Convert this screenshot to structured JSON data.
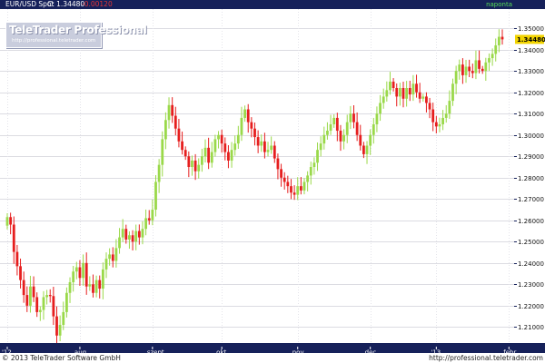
{
  "header": {
    "symbol": "EUR/USD Spot",
    "close": "C: 1.34480",
    "change": "-0.00120",
    "period": "naponta"
  },
  "logo": {
    "title": "TeleTrader Professional",
    "url": "http://professional.teletrader.com"
  },
  "footer": {
    "copyright": "© 2013 TeleTrader Software GmbH",
    "url": "http://professional.teletrader.com"
  },
  "colors": {
    "up": "#9ad94a",
    "down": "#e61e1e",
    "axis_bar": "#16215a",
    "last_price_box": "#f2d400"
  },
  "chart_data": {
    "type": "candlestick",
    "title": "",
    "xlabel": "",
    "ylabel": "",
    "ylim": [
      1.2025,
      1.359
    ],
    "grid": true,
    "y_axis_position": "right",
    "last_price": "1.34480",
    "y_ticks": [
      "1.21000",
      "1.22000",
      "1.23000",
      "1.24000",
      "1.25000",
      "1.26000",
      "1.27000",
      "1.28000",
      "1.29000",
      "1.30000",
      "1.31000",
      "1.32000",
      "1.33000",
      "1.34000",
      "1.35000"
    ],
    "x_tick_labels": [
      {
        "label": "'12",
        "index": 0
      },
      {
        "label": "aug.",
        "index": 22
      },
      {
        "label": "szept.",
        "index": 44
      },
      {
        "label": "okt.",
        "index": 65
      },
      {
        "label": "nov.",
        "index": 88
      },
      {
        "label": "dec.",
        "index": 110
      },
      {
        "label": "'13",
        "index": 130
      },
      {
        "label": "febr.",
        "index": 152
      }
    ],
    "closes": [
      1.2615,
      1.258,
      1.2452,
      1.2385,
      1.232,
      1.225,
      1.22,
      1.229,
      1.224,
      1.217,
      1.218,
      1.224,
      1.225,
      1.2245,
      1.215,
      1.206,
      1.211,
      1.217,
      1.226,
      1.231,
      1.236,
      1.238,
      1.233,
      1.24,
      1.229,
      1.23,
      1.226,
      1.232,
      1.228,
      1.237,
      1.242,
      1.244,
      1.241,
      1.247,
      1.252,
      1.256,
      1.251,
      1.253,
      1.25,
      1.255,
      1.252,
      1.256,
      1.261,
      1.26,
      1.265,
      1.278,
      1.286,
      1.298,
      1.307,
      1.314,
      1.309,
      1.303,
      1.297,
      1.293,
      1.29,
      1.285,
      1.288,
      1.283,
      1.286,
      1.29,
      1.294,
      1.287,
      1.292,
      1.298,
      1.3,
      1.296,
      1.292,
      1.288,
      1.293,
      1.296,
      1.3,
      1.308,
      1.312,
      1.306,
      1.303,
      1.299,
      1.295,
      1.297,
      1.292,
      1.293,
      1.295,
      1.289,
      1.284,
      1.28,
      1.278,
      1.276,
      1.273,
      1.272,
      1.276,
      1.274,
      1.278,
      1.281,
      1.285,
      1.287,
      1.293,
      1.296,
      1.3,
      1.302,
      1.305,
      1.308,
      1.302,
      1.297,
      1.3,
      1.306,
      1.31,
      1.306,
      1.3,
      1.295,
      1.291,
      1.295,
      1.3,
      1.305,
      1.31,
      1.315,
      1.318,
      1.321,
      1.325,
      1.322,
      1.318,
      1.322,
      1.317,
      1.322,
      1.319,
      1.324,
      1.32,
      1.317,
      1.318,
      1.315,
      1.312,
      1.306,
      1.304,
      1.305,
      1.308,
      1.31,
      1.316,
      1.324,
      1.33,
      1.333,
      1.328,
      1.332,
      1.33,
      1.329,
      1.335,
      1.331,
      1.33,
      1.334,
      1.336,
      1.338,
      1.342,
      1.346,
      1.3448
    ]
  }
}
